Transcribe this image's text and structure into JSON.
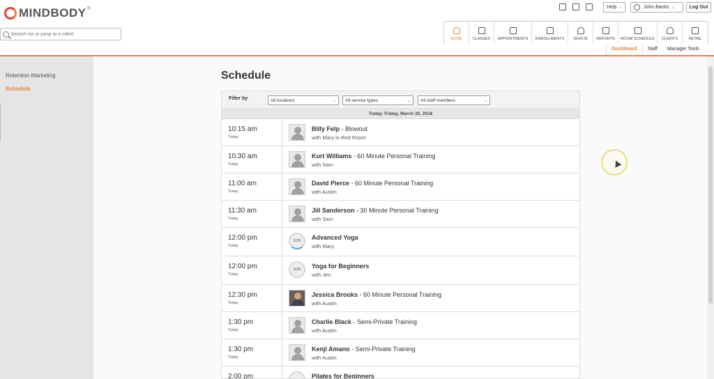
{
  "brand": {
    "name": "MINDBODY",
    "reg": "®",
    "accent": "#e8833a",
    "logo_red": "#d8462f"
  },
  "search": {
    "placeholder": "Search for or jump to a client"
  },
  "utility": {
    "icons": [
      "calendar-icon",
      "close-box-icon",
      "checkbox-icon"
    ],
    "help_label": "Help",
    "user_name": "John Banks",
    "logout_label": "Log Out"
  },
  "nav": [
    {
      "label": "HOME",
      "icon": "home-icon",
      "active": true
    },
    {
      "label": "CLASSES",
      "icon": "classes-icon"
    },
    {
      "label": "APPOINTMENTS",
      "icon": "appointments-icon"
    },
    {
      "label": "ENROLLMENTS",
      "icon": "enrollments-icon"
    },
    {
      "label": "SIGN IN",
      "icon": "sign-in-icon"
    },
    {
      "label": "REPORTS",
      "icon": "reports-icon"
    },
    {
      "label": "ROOM SCHEDULE",
      "icon": "room-schedule-icon"
    },
    {
      "label": "CLIENTS",
      "icon": "clients-icon"
    },
    {
      "label": "RETAIL",
      "icon": "retail-icon"
    }
  ],
  "subnav": {
    "dashboard": "Dashboard",
    "staff": "Staff",
    "manager_tools": "Manager Tools"
  },
  "sidebar": {
    "retention": "Retention Marketing",
    "schedule": "Schedule"
  },
  "page": {
    "title": "Schedule"
  },
  "filters": {
    "label": "Filter by",
    "locations": "All locations",
    "service_types": "All service types",
    "staff": "All staff members"
  },
  "date_header": "Today: Friday, March 30, 2018",
  "rows": [
    {
      "time": "10:15 am",
      "day": "Today",
      "name": "Billy Felp",
      "service": " - Blowout",
      "sub": "with Mary in Red Room",
      "kind": "avatar"
    },
    {
      "time": "10:30 am",
      "day": "Today",
      "name": "Kurt Williams",
      "service": " - 60 Minute Personal Training",
      "sub": "with Sam",
      "kind": "avatar"
    },
    {
      "time": "11:00 am",
      "day": "Today",
      "name": "David Pierce",
      "service": " - 60 Minute Personal Training",
      "sub": "with Austin",
      "kind": "avatar"
    },
    {
      "time": "11:30 am",
      "day": "Today",
      "name": "Jill Sanderson",
      "service": " - 30 Minute Personal Training",
      "sub": "with Sam",
      "kind": "avatar"
    },
    {
      "time": "12:00 pm",
      "day": "Today",
      "name": "Advanced Yoga",
      "service": "",
      "sub": "with Mary",
      "kind": "capacity",
      "capacity": "3/20"
    },
    {
      "time": "12:00 pm",
      "day": "Today",
      "name": "Yoga for Beginners",
      "service": "",
      "sub": "with Jen",
      "kind": "capacity",
      "capacity": "0/20"
    },
    {
      "time": "12:30 pm",
      "day": "Today",
      "name": "Jessica Brooks",
      "service": " - 60 Minute Personal Training",
      "sub": "with Austin",
      "kind": "photo"
    },
    {
      "time": "1:30 pm",
      "day": "Today",
      "name": "Charlie Black",
      "service": " - Semi-Private Training",
      "sub": "with Austin",
      "kind": "avatar"
    },
    {
      "time": "1:30 pm",
      "day": "Today",
      "name": "Kenji Amano",
      "service": " - Semi-Private Training",
      "sub": "with Austin",
      "kind": "avatar"
    },
    {
      "time": "2:00 pm",
      "day": "Today",
      "name": "Pilates for Beginners",
      "service": "",
      "sub": "",
      "kind": "capacity",
      "capacity": ""
    }
  ]
}
